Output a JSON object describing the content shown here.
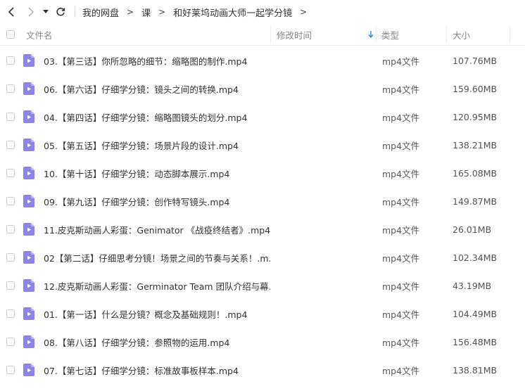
{
  "breadcrumb": [
    "我的网盘",
    "课",
    "和好莱坞动画大师一起学分镜"
  ],
  "breadcrumb_sep": ">",
  "columns": {
    "name": "文件名",
    "modified": "修改时间",
    "type": "类型",
    "size": "大小"
  },
  "files": [
    {
      "name": "03.【第三话】你所忽略的细节：缩略图的制作.mp4",
      "type": "mp4文件",
      "size": "107.76MB"
    },
    {
      "name": "06.【第六话】仔细学分镜：镜头之间的转换.mp4",
      "type": "mp4文件",
      "size": "159.60MB"
    },
    {
      "name": "04.【第四话】仔细学分镜：缩略图镜头的划分.mp4",
      "type": "mp4文件",
      "size": "120.95MB"
    },
    {
      "name": "05.【第五话】仔细学分镜：场景片段的设计.mp4",
      "type": "mp4文件",
      "size": "138.21MB"
    },
    {
      "name": "10.【第十话】仔细学分镜：动态脚本展示.mp4",
      "type": "mp4文件",
      "size": "165.08MB"
    },
    {
      "name": "09.【第九话】仔细学分镜：创作特写镜头.mp4",
      "type": "mp4文件",
      "size": "149.87MB"
    },
    {
      "name": "11.皮克斯动画人彩蛋：Genimator 《战疫终结者》.mp4",
      "type": "mp4文件",
      "size": "26.01MB"
    },
    {
      "name": "02【第二话】仔细思考分镜！场景之间的节奏与关系！.m...",
      "type": "mp4文件",
      "size": "102.34MB"
    },
    {
      "name": "12.皮克斯动画人彩蛋：Germinator Team 团队介绍与幕...",
      "type": "mp4文件",
      "size": "43.19MB"
    },
    {
      "name": "01.【第一话】什么是分镜？概念及基础规则！.mp4",
      "type": "mp4文件",
      "size": "104.49MB"
    },
    {
      "name": "08.【第八话】仔细学分镜：参照物的运用.mp4",
      "type": "mp4文件",
      "size": "156.48MB"
    },
    {
      "name": "07.【第七话】仔细学分镜：标准故事板样本.mp4",
      "type": "mp4文件",
      "size": "138.81MB"
    }
  ],
  "colors": {
    "accent": "#1e8fe6",
    "file_icon": "#8b85e8",
    "file_icon_fold": "#b8b3f3"
  },
  "icons": {
    "back": "chevron-left-icon",
    "forward": "chevron-right-icon",
    "more": "caret-down-icon",
    "refresh": "refresh-icon",
    "sort": "sort-down-arrow-icon",
    "file": "video-file-icon"
  }
}
